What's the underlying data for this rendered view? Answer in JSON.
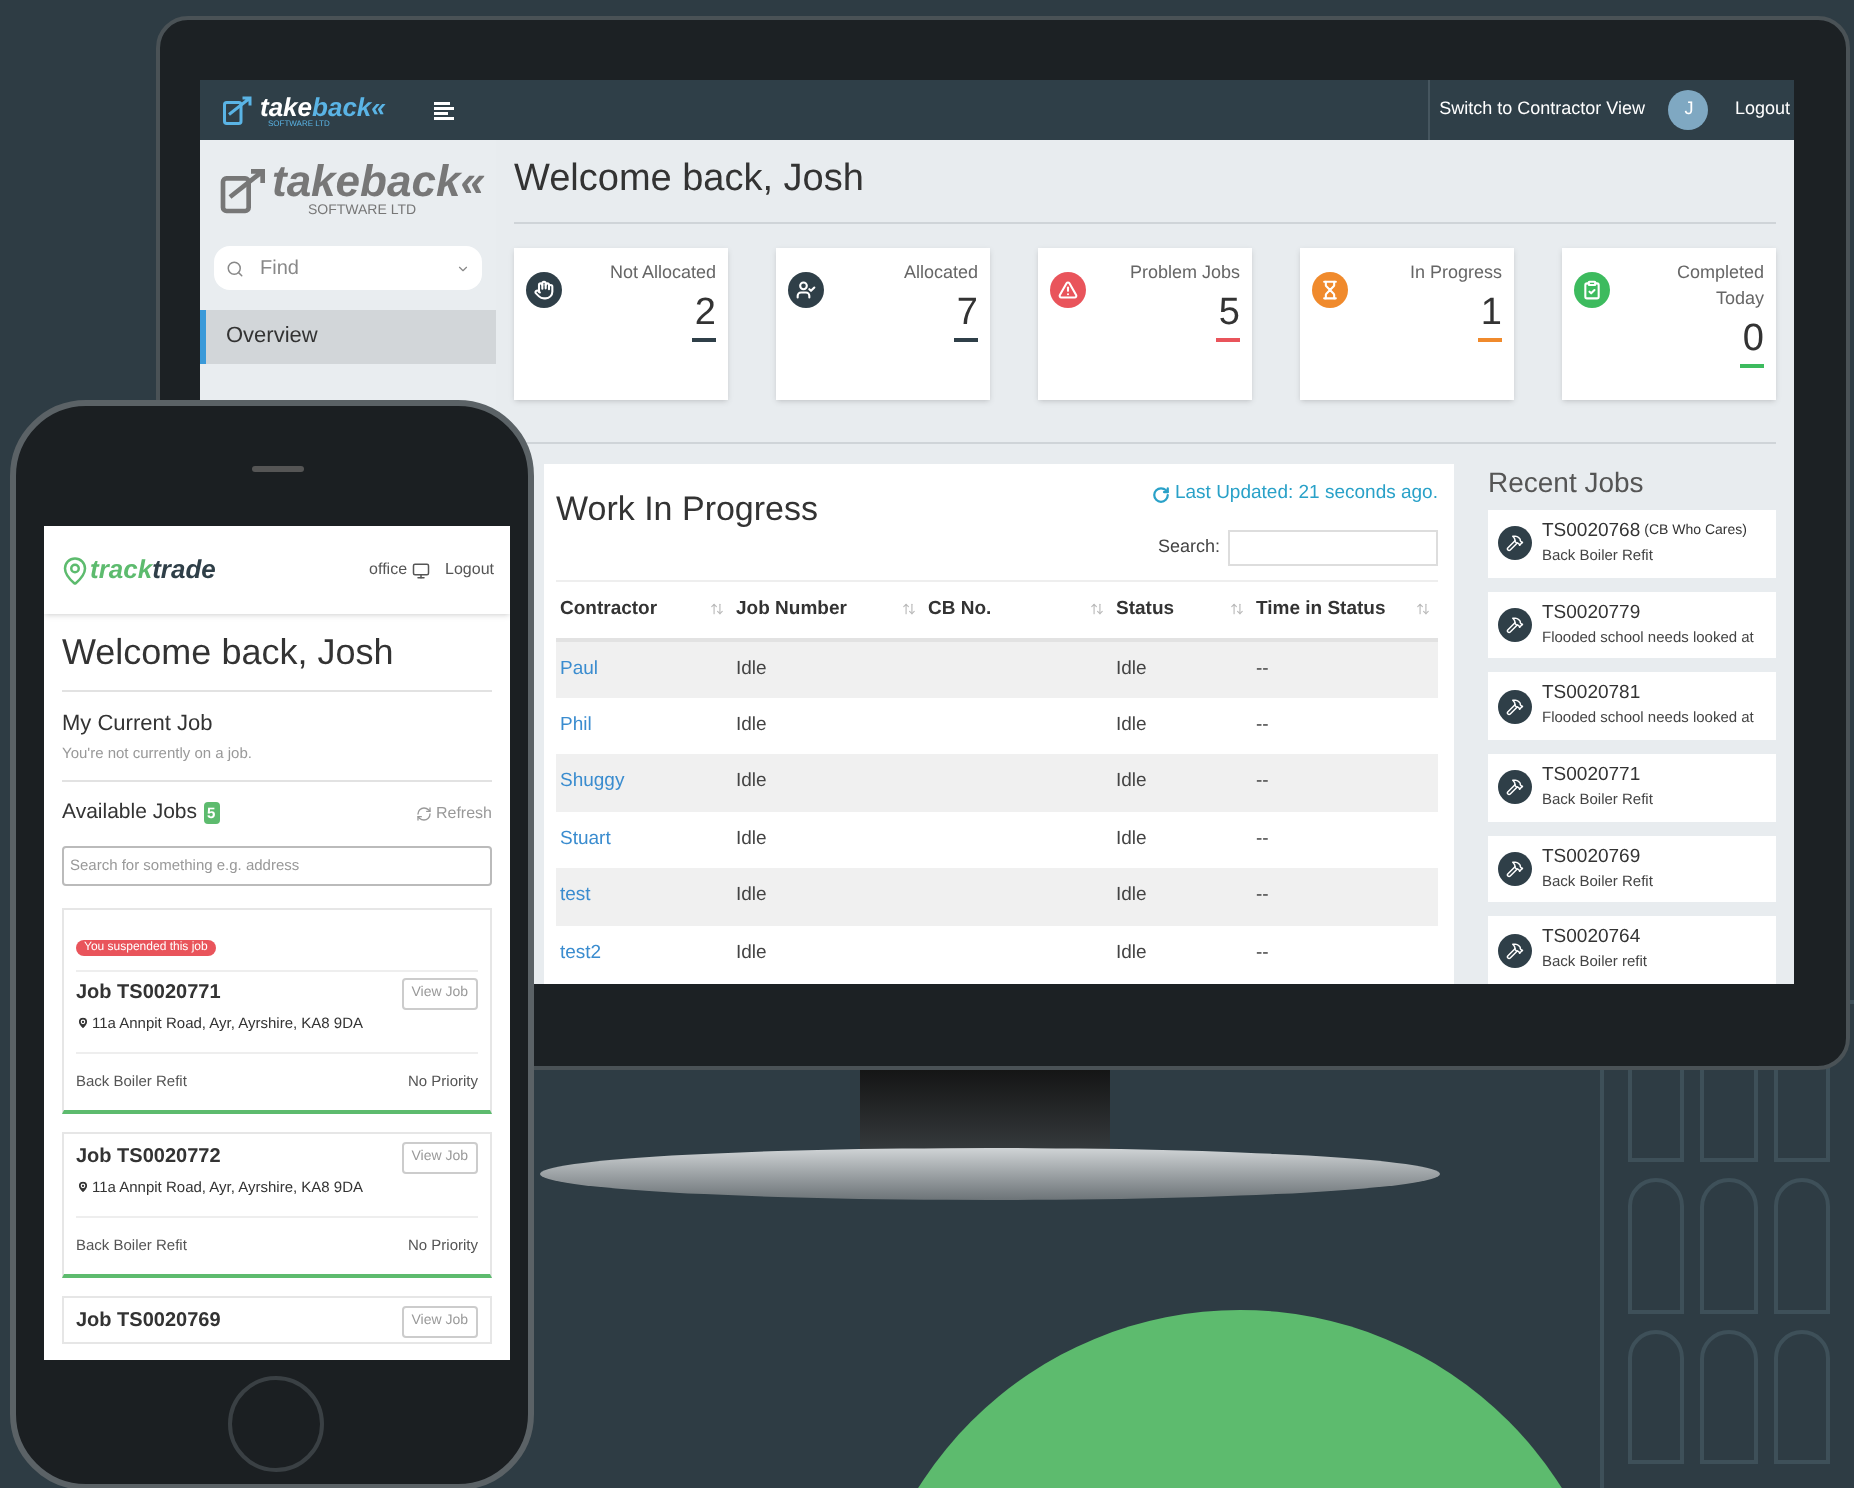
{
  "desktop": {
    "topbar": {
      "logo": {
        "part_a": "take",
        "part_b": "back",
        "mark": "«",
        "sub": "SOFTWARE LTD"
      },
      "switch_link": "Switch to Contractor View",
      "avatar": "J",
      "logout": "Logout"
    },
    "sidebar": {
      "logo": {
        "part_a": "takeback",
        "mark": "«",
        "sub": "SOFTWARE LTD"
      },
      "search": {
        "placeholder": "Find"
      },
      "items": [
        {
          "label": "Overview",
          "selected": true
        }
      ]
    },
    "title": "Welcome back, Josh",
    "stats": [
      {
        "label": "Not Allocated",
        "value": "2",
        "color": "#2f3f48",
        "kind": "hand"
      },
      {
        "label": "Allocated",
        "value": "7",
        "color": "#2f3f48",
        "kind": "user"
      },
      {
        "label": "Problem Jobs",
        "value": "5",
        "color": "#e9545b",
        "kind": "warning"
      },
      {
        "label": "In Progress",
        "value": "1",
        "color": "#f08a2c",
        "kind": "hourglass"
      },
      {
        "label": "Completed Today",
        "value": "0",
        "color": "#3dbb5e",
        "kind": "clipboard"
      }
    ],
    "work_in_progress": {
      "title": "Work In Progress",
      "updated": "Last Updated: 21 seconds ago.",
      "search_label": "Search:",
      "columns": [
        "Contractor",
        "Job Number",
        "CB No.",
        "Status",
        "Time in Status"
      ],
      "rows": [
        [
          "Paul",
          "Idle",
          "",
          "Idle",
          "--"
        ],
        [
          "Phil",
          "Idle",
          "",
          "Idle",
          "--"
        ],
        [
          "Shuggy",
          "Idle",
          "",
          "Idle",
          "--"
        ],
        [
          "Stuart",
          "Idle",
          "",
          "Idle",
          "--"
        ],
        [
          "test",
          "Idle",
          "",
          "Idle",
          "--"
        ],
        [
          "test2",
          "Idle",
          "",
          "Idle",
          "--"
        ]
      ]
    },
    "recent_jobs": {
      "title": "Recent Jobs",
      "items": [
        {
          "number": "TS0020768",
          "note": "(CB Who Cares)",
          "description": "Back Boiler Refit"
        },
        {
          "number": "TS0020779",
          "description": "Flooded school needs looked at"
        },
        {
          "number": "TS0020781",
          "description": "Flooded school needs looked at"
        },
        {
          "number": "TS0020771",
          "description": "Back Boiler Refit"
        },
        {
          "number": "TS0020769",
          "description": "Back Boiler Refit"
        },
        {
          "number": "TS0020764",
          "description": "Back Boiler refit"
        }
      ]
    }
  },
  "phone": {
    "header": {
      "logo": {
        "part_a": "track",
        "part_b": "trade"
      },
      "office": "office",
      "logout": "Logout"
    },
    "title": "Welcome back, Josh",
    "current_job": {
      "heading": "My Current Job",
      "note": "You're not currently on a job."
    },
    "available": {
      "heading": "Available Jobs",
      "count": "5",
      "refresh": "Refresh"
    },
    "search": {
      "placeholder": "Search for something e.g. address"
    },
    "jobs": [
      {
        "badge": "You suspended this job",
        "title": "Job TS0020771",
        "button": "View Job",
        "address": "11a Annpit Road, Ayr, Ayrshire, KA8 9DA",
        "description": "Back Boiler Refit",
        "priority": "No Priority"
      },
      {
        "title": "Job TS0020772",
        "button": "View Job",
        "address": "11a Annpit Road, Ayr, Ayrshire, KA8 9DA",
        "description": "Back Boiler Refit",
        "priority": "No Priority"
      },
      {
        "title": "Job TS0020769",
        "button": "View Job"
      }
    ]
  }
}
